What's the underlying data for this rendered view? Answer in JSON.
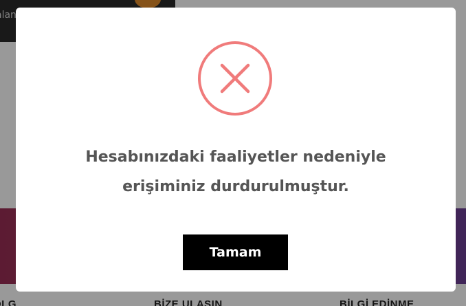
{
  "background": {
    "topbar_text": "alan",
    "footer_labels": [
      "OLG",
      "BİZE ULAŞIN",
      "BİLGİ EDİNME"
    ]
  },
  "dialog": {
    "icon": "error-x-circle-icon",
    "message": "Hesabınızdaki faaliyetler nedeniyle erişiminiz durdurulmuştur.",
    "confirm_label": "Tamam"
  },
  "colors": {
    "error_accent": "#f07b7b",
    "overlay": "rgba(0,0,0,0.4)",
    "button_bg": "#000000",
    "button_text": "#ffffff",
    "message_text": "#555555",
    "band_start": "#9a2e55",
    "band_end": "#6b3f93"
  }
}
